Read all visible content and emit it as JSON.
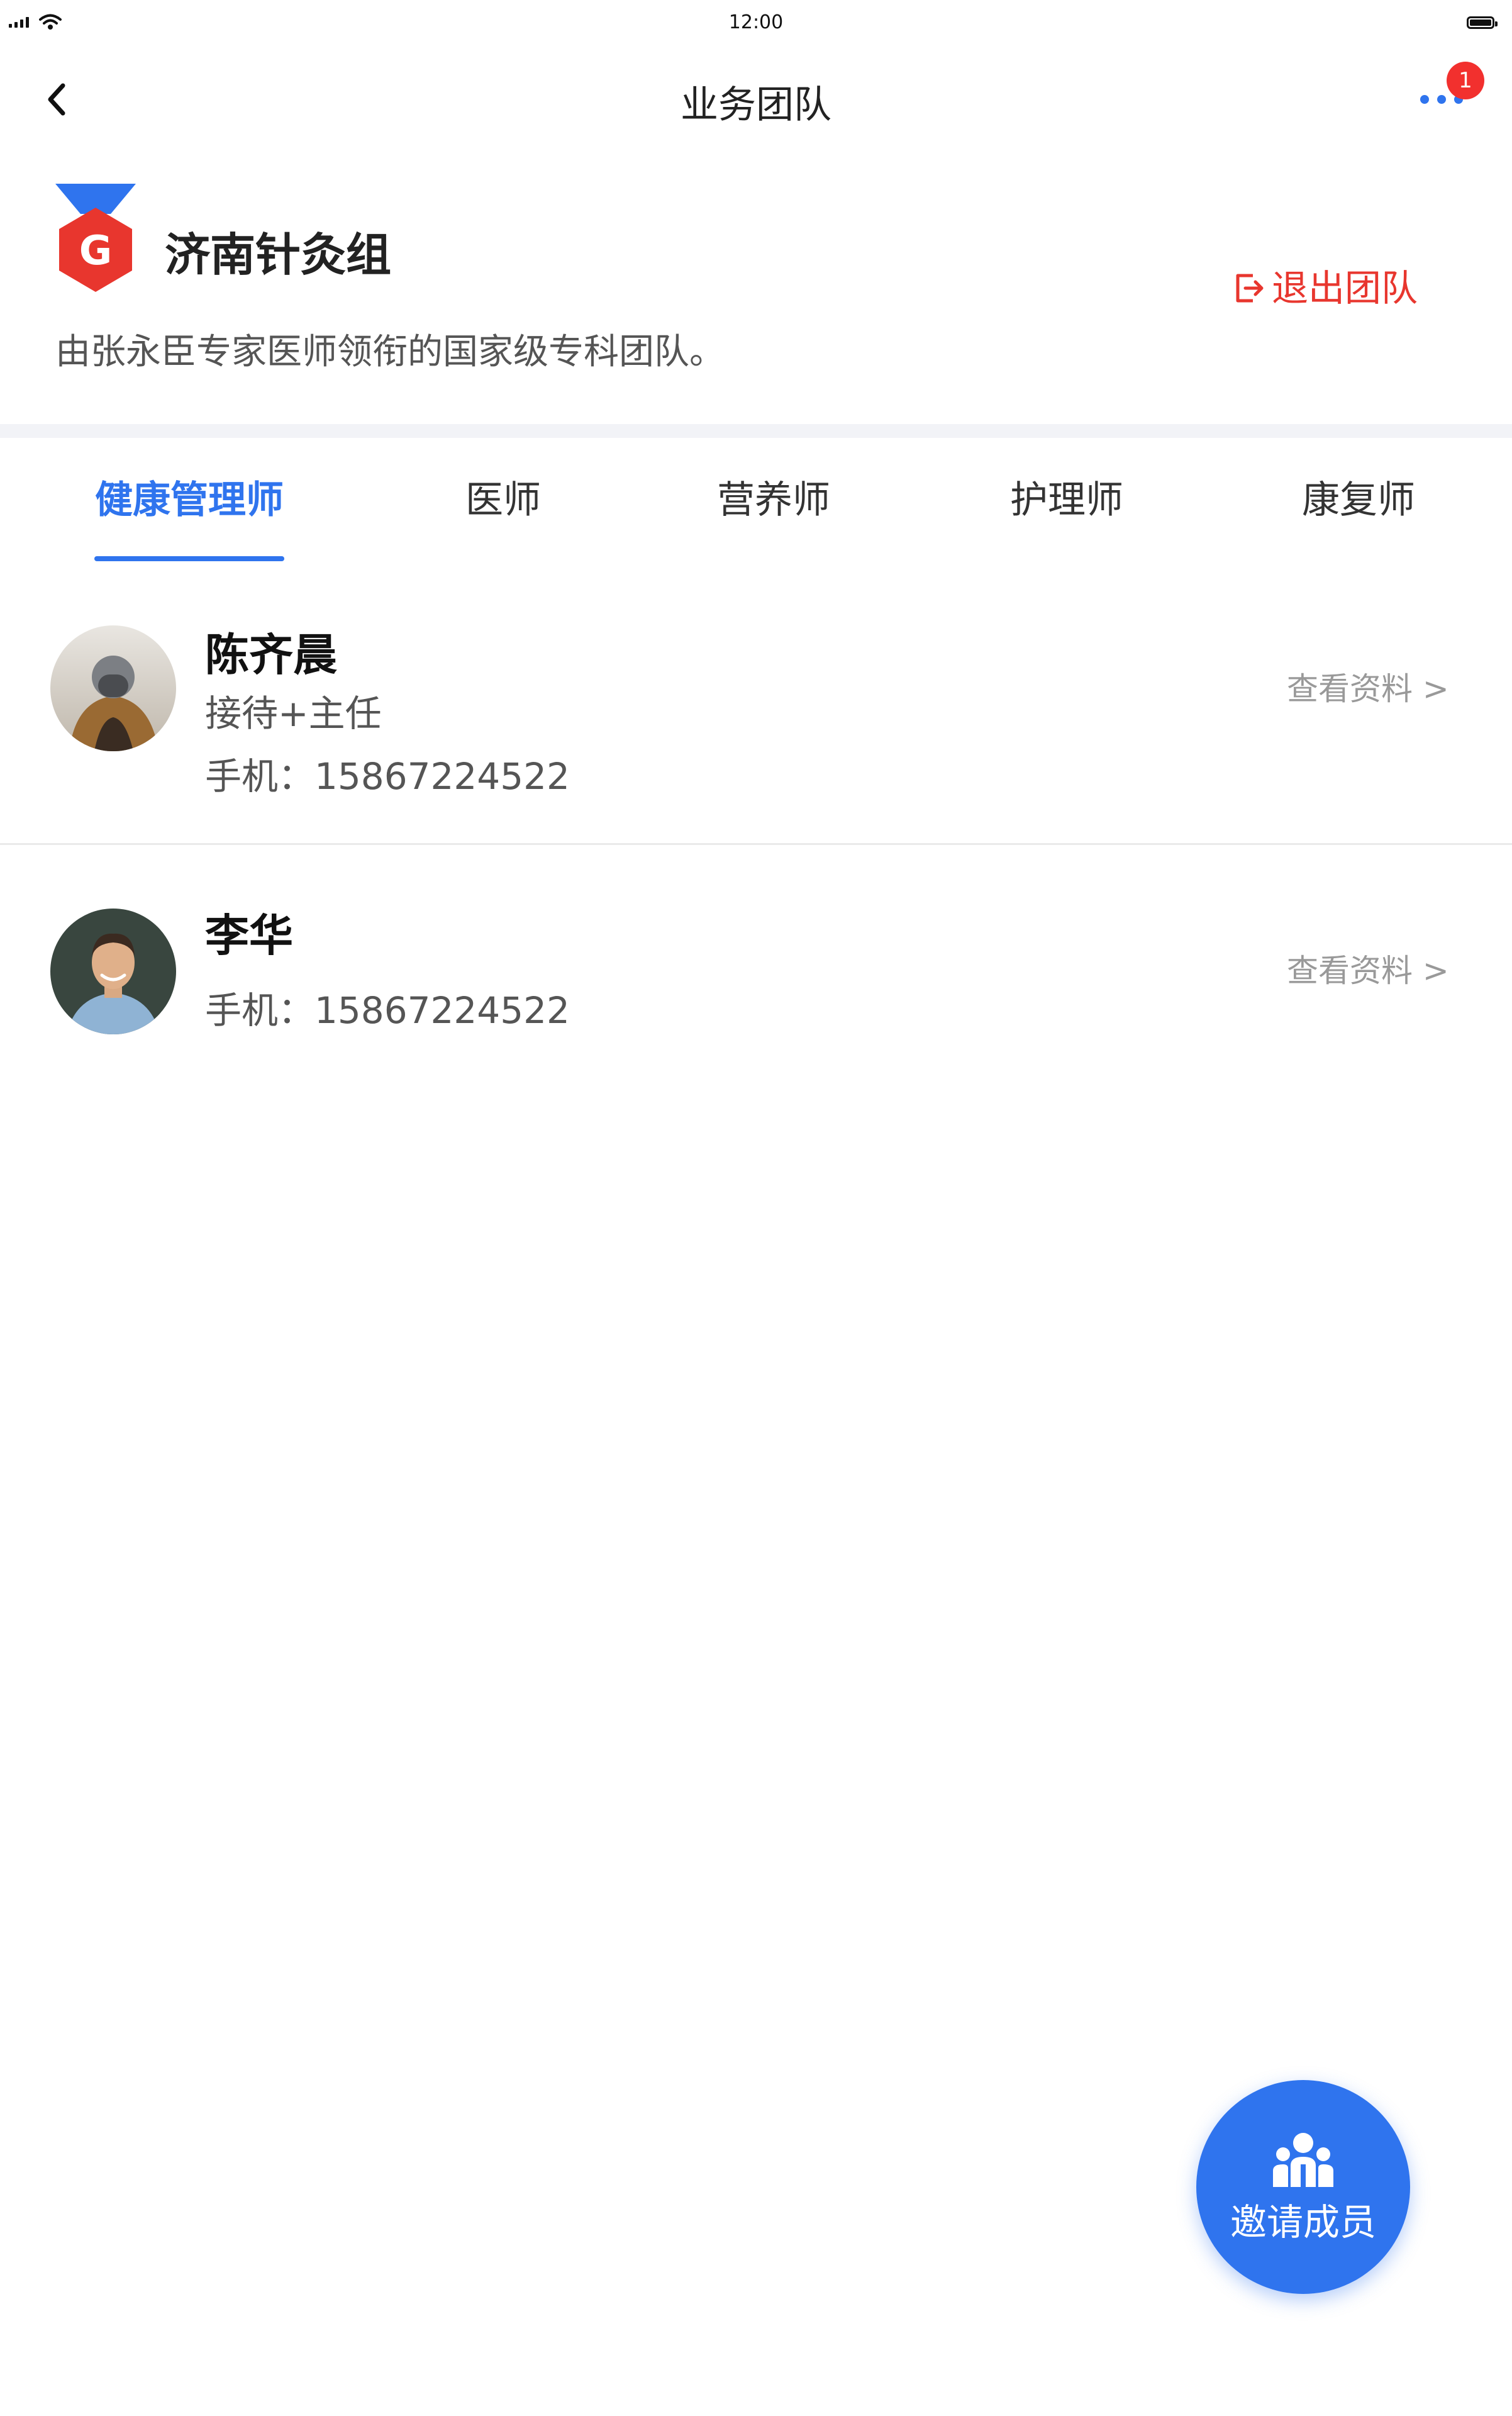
{
  "status_bar": {
    "time": "12:00"
  },
  "nav": {
    "title": "业务团队",
    "notification_count": "1"
  },
  "team": {
    "name": "济南针灸组",
    "logo_letter": "G",
    "description": "由张永臣专家医师领衔的国家级专科团队。",
    "leave_label": "退出团队"
  },
  "tabs": [
    {
      "label": "健康管理师",
      "active": true
    },
    {
      "label": "医师",
      "active": false
    },
    {
      "label": "营养师",
      "active": false
    },
    {
      "label": "护理师",
      "active": false
    },
    {
      "label": "康复师",
      "active": false
    }
  ],
  "members": [
    {
      "name": "陈齐晨",
      "role": "接待+主任",
      "phone": "手机：15867224522",
      "link": "查看资料 >"
    },
    {
      "name": "李华",
      "phone": "手机：15867224522",
      "link": "查看资料 >"
    }
  ],
  "fab": {
    "label": "邀请成员"
  },
  "colors": {
    "accent": "#2F74EE",
    "danger": "#E8362E",
    "badge": "#F2302E"
  }
}
